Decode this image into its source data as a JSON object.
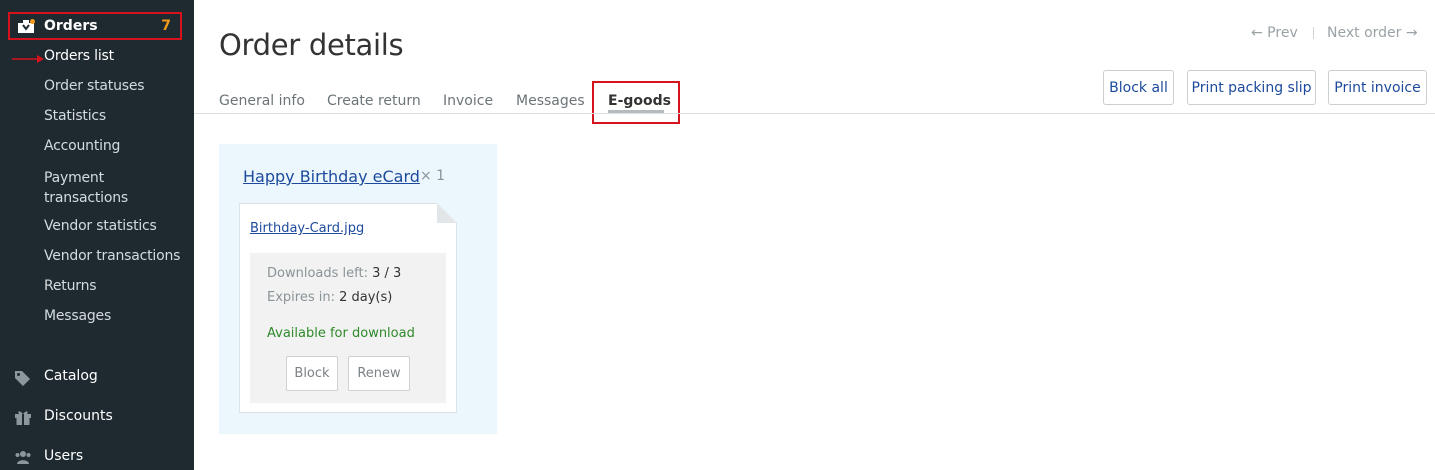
{
  "sidebar": {
    "orders": {
      "label": "Orders",
      "count": "7"
    },
    "items": [
      {
        "label": "Orders list"
      },
      {
        "label": "Order statuses"
      },
      {
        "label": "Statistics"
      },
      {
        "label": "Accounting"
      },
      {
        "label": "Payment transactions"
      },
      {
        "label": "Vendor statistics"
      },
      {
        "label": "Vendor transactions"
      },
      {
        "label": "Returns"
      },
      {
        "label": "Messages"
      }
    ],
    "payment_line1": "Payment",
    "payment_line2": "transactions",
    "sections": [
      {
        "label": "Catalog",
        "icon": "tags-icon"
      },
      {
        "label": "Discounts",
        "icon": "gift-icon"
      },
      {
        "label": "Users",
        "icon": "users-icon"
      }
    ]
  },
  "header": {
    "title": "Order details",
    "prev": "← Prev",
    "next": "Next order →"
  },
  "tabs": [
    {
      "label": "General info"
    },
    {
      "label": "Create return"
    },
    {
      "label": "Invoice"
    },
    {
      "label": "Messages"
    },
    {
      "label": "E-goods",
      "active": true
    }
  ],
  "actions": {
    "block_all": "Block all",
    "print_packing_slip": "Print packing slip",
    "print_invoice": "Print invoice"
  },
  "egood": {
    "title": "Happy Birthday eCard",
    "quantity": "× 1",
    "file": {
      "name": "Birthday-Card.jpg",
      "downloads_left_label": "Downloads left:",
      "downloads_left_value": "3 / 3",
      "expires_label": "Expires in:",
      "expires_value": "2 day(s)",
      "status": "Available for download",
      "block_label": "Block",
      "renew_label": "Renew"
    }
  },
  "colors": {
    "sidebar_bg": "#1f2a30",
    "accent_red": "#d6121c",
    "count_orange": "#f39a1b",
    "link_blue": "#1d4a9c",
    "available_green": "#2e8a2a",
    "egood_panel_bg": "#ecf7fd"
  }
}
